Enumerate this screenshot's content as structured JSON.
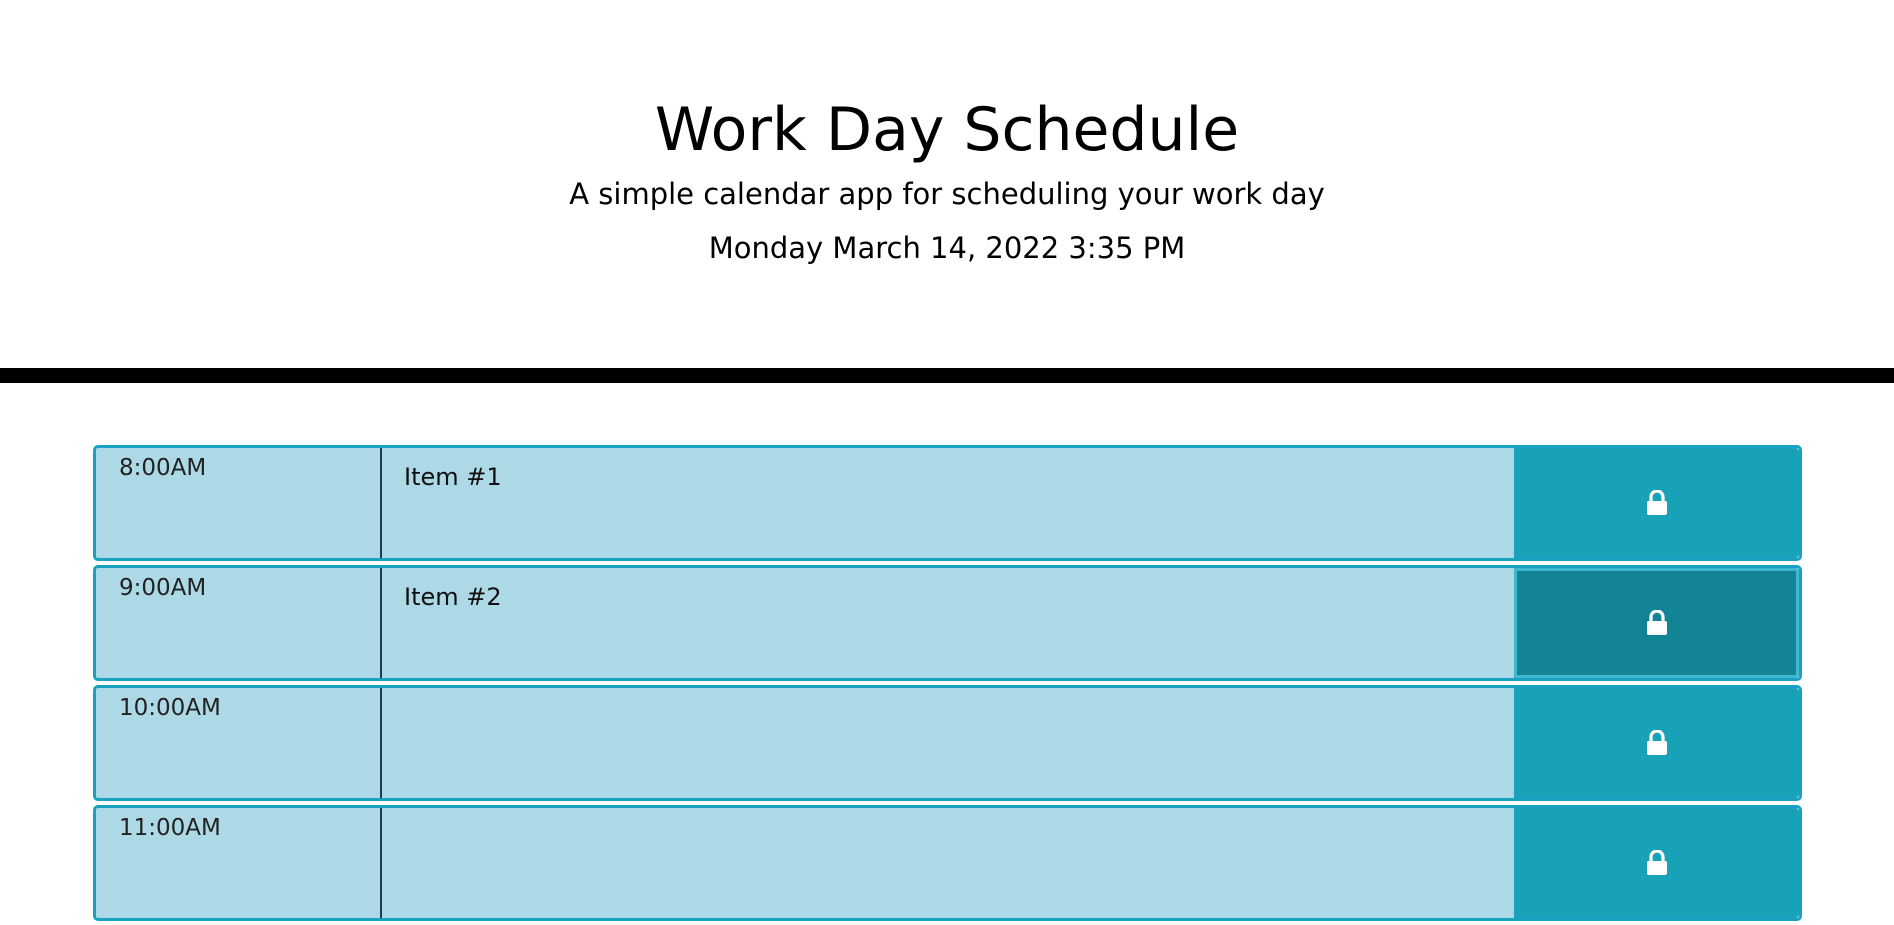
{
  "header": {
    "title": "Work Day Schedule",
    "subtitle": "A simple calendar app for scheduling your work day",
    "current_day": "Monday March 14, 2022 3:35 PM"
  },
  "colors": {
    "row_background": "#add8e6",
    "row_border": "#1aa1c2",
    "save_button": "#17a2b8",
    "save_button_active": "#138496",
    "divider": "#000000"
  },
  "time_blocks": [
    {
      "hour": "8:00AM",
      "text": "Item #1",
      "icon": "lock-icon"
    },
    {
      "hour": "9:00AM",
      "text": "Item #2",
      "icon": "lock-icon"
    },
    {
      "hour": "10:00AM",
      "text": "",
      "icon": "lock-icon"
    },
    {
      "hour": "11:00AM",
      "text": "",
      "icon": "lock-icon"
    }
  ]
}
